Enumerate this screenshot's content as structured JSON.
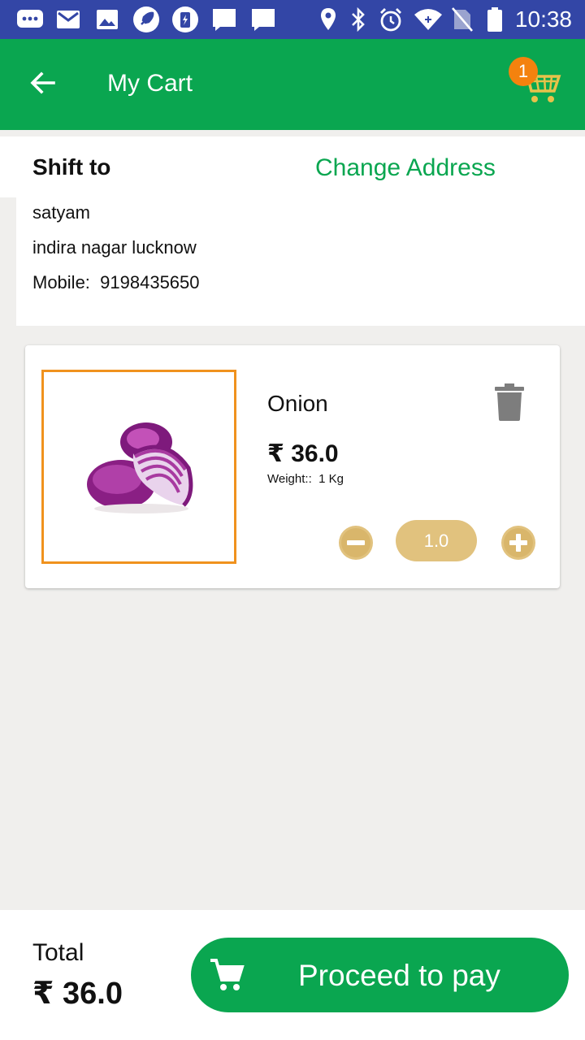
{
  "status_bar": {
    "time": "10:38",
    "icons": [
      "messages-icon",
      "gmail-icon",
      "gallery-icon",
      "rocket-icon",
      "phone-cleaner-icon",
      "notification-icon",
      "notification-icon",
      "location-icon",
      "bluetooth-icon",
      "alarm-icon",
      "wifi-icon",
      "no-sim-icon",
      "battery-icon"
    ]
  },
  "appbar": {
    "title": "My Cart",
    "back_icon": "arrow-left-icon",
    "cart_icon": "shopping-cart-icon",
    "cart_count": "1",
    "color": "#0aa650"
  },
  "address": {
    "heading": "Shift to",
    "change_label": "Change Address",
    "name": "satyam",
    "line": "indira nagar lucknow",
    "mobile_label": "Mobile:",
    "mobile": "9198435650"
  },
  "cart_items": [
    {
      "name": "Onion",
      "price": "₹ 36.0",
      "weight_label": "Weight::",
      "weight": "1 Kg",
      "quantity": "1.0",
      "delete_icon": "trash-icon",
      "minus_icon": "minus-circle-icon",
      "plus_icon": "plus-circle-icon"
    }
  ],
  "footer": {
    "total_label": "Total",
    "total_value": "₹ 36.0",
    "pay_label": "Proceed to pay",
    "pay_icon": "cart-icon"
  },
  "colors": {
    "status_bar": "#3346a6",
    "primary_green": "#0aa650",
    "accent_orange": "#f0921e",
    "qty_gold": "#e1c27e",
    "background": "#f0efed"
  }
}
